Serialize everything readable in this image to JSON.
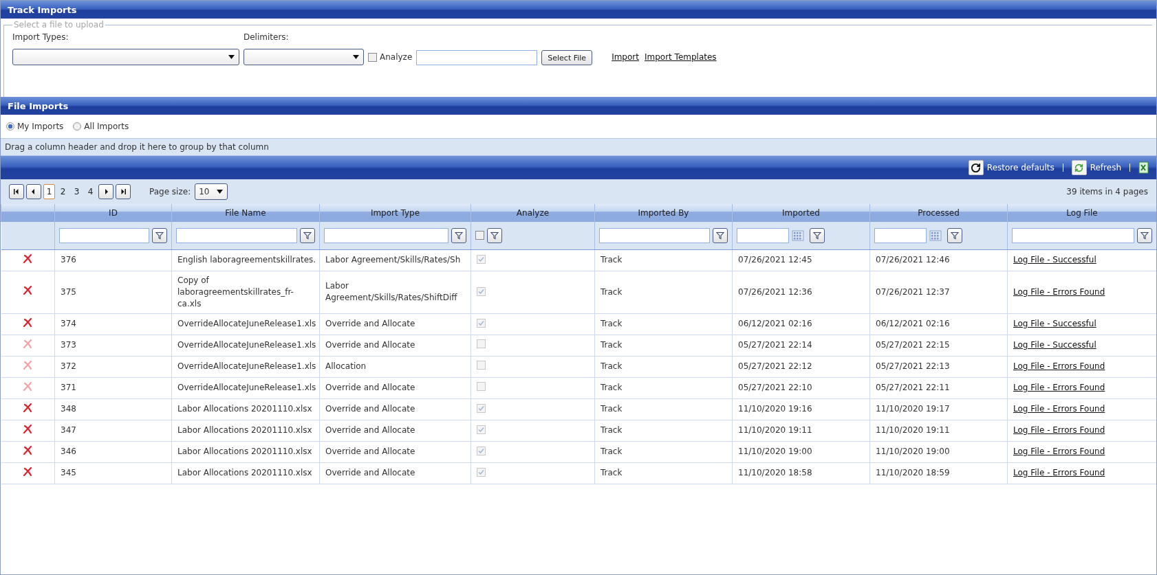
{
  "window": {
    "title": "Track Imports"
  },
  "upload": {
    "legend": "Select a file to upload",
    "import_types_label": "Import Types:",
    "delimiters_label": "Delimiters:",
    "analyze": {
      "label": "Analyze",
      "checked": false
    },
    "select_file_button": "Select File",
    "links": [
      "Import",
      "Import Templates"
    ]
  },
  "file_imports": {
    "title": "File Imports",
    "scope": [
      {
        "label": "My Imports",
        "selected": true
      },
      {
        "label": "All Imports",
        "selected": false
      }
    ],
    "group_hint": "Drag a column header and drop it here to group by that column",
    "toolbar": [
      {
        "kind": "restore",
        "label": "Restore defaults"
      },
      {
        "kind": "refresh",
        "label": "Refresh"
      },
      {
        "kind": "export"
      }
    ],
    "pager": {
      "pages": [
        {
          "label": "1",
          "selected": true
        },
        {
          "label": "2",
          "selected": false
        },
        {
          "label": "3",
          "selected": false
        },
        {
          "label": "4",
          "selected": false
        }
      ],
      "page_size_label": "Page size:",
      "page_size": "10",
      "summary": "39 items in 4 pages"
    },
    "table": {
      "columns": [
        {
          "label": "ID",
          "kind": "text"
        },
        {
          "label": "File Name",
          "kind": "text"
        },
        {
          "label": "Import Type",
          "kind": "text"
        },
        {
          "label": "Analyze",
          "kind": "checkbox",
          "checked": false
        },
        {
          "label": "Imported By",
          "kind": "text"
        },
        {
          "label": "Imported",
          "kind": "date"
        },
        {
          "label": "Processed",
          "kind": "date"
        },
        {
          "label": "Log File",
          "kind": "text"
        }
      ],
      "rows": [
        {
          "deletable": true,
          "id": "376",
          "file_name": "English laboragreementskillrates.",
          "import_type": "Labor Agreement/Skills/Rates/Sh",
          "analyze": true,
          "imported_by": "Track",
          "imported": "07/26/2021 12:45",
          "processed": "07/26/2021 12:46",
          "log_file": "Log File - Successful"
        },
        {
          "deletable": true,
          "id": "375",
          "file_name": "Copy of laboragreementskillrates_fr-ca.xls",
          "import_type": "Labor Agreement/Skills/Rates/ShiftDiff",
          "analyze": true,
          "imported_by": "Track",
          "imported": "07/26/2021 12:36",
          "processed": "07/26/2021 12:37",
          "log_file": "Log File - Errors Found"
        },
        {
          "deletable": true,
          "id": "374",
          "file_name": "OverrideAllocateJuneRelease1.xls",
          "import_type": "Override and Allocate",
          "analyze": true,
          "imported_by": "Track",
          "imported": "06/12/2021 02:16",
          "processed": "06/12/2021 02:16",
          "log_file": "Log File - Successful"
        },
        {
          "deletable": false,
          "id": "373",
          "file_name": "OverrideAllocateJuneRelease1.xls",
          "import_type": "Override and Allocate",
          "analyze": false,
          "imported_by": "Track",
          "imported": "05/27/2021 22:14",
          "processed": "05/27/2021 22:15",
          "log_file": "Log File - Successful"
        },
        {
          "deletable": false,
          "id": "372",
          "file_name": "OverrideAllocateJuneRelease1.xls",
          "import_type": "Allocation",
          "analyze": false,
          "imported_by": "Track",
          "imported": "05/27/2021 22:12",
          "processed": "05/27/2021 22:13",
          "log_file": "Log File - Errors Found"
        },
        {
          "deletable": false,
          "id": "371",
          "file_name": "OverrideAllocateJuneRelease1.xls",
          "import_type": "Override and Allocate",
          "analyze": false,
          "imported_by": "Track",
          "imported": "05/27/2021 22:10",
          "processed": "05/27/2021 22:11",
          "log_file": "Log File - Errors Found"
        },
        {
          "deletable": true,
          "id": "348",
          "file_name": "Labor Allocations 20201110.xlsx",
          "import_type": "Override and Allocate",
          "analyze": true,
          "imported_by": "Track",
          "imported": "11/10/2020 19:16",
          "processed": "11/10/2020 19:17",
          "log_file": "Log File - Errors Found"
        },
        {
          "deletable": true,
          "id": "347",
          "file_name": "Labor Allocations 20201110.xlsx",
          "import_type": "Override and Allocate",
          "analyze": true,
          "imported_by": "Track",
          "imported": "11/10/2020 19:11",
          "processed": "11/10/2020 19:11",
          "log_file": "Log File - Errors Found"
        },
        {
          "deletable": true,
          "id": "346",
          "file_name": "Labor Allocations 20201110.xlsx",
          "import_type": "Override and Allocate",
          "analyze": true,
          "imported_by": "Track",
          "imported": "11/10/2020 19:00",
          "processed": "11/10/2020 19:00",
          "log_file": "Log File - Errors Found"
        },
        {
          "deletable": true,
          "id": "345",
          "file_name": "Labor Allocations 20201110.xlsx",
          "import_type": "Override and Allocate",
          "analyze": true,
          "imported_by": "Track",
          "imported": "11/10/2020 18:58",
          "processed": "11/10/2020 18:59",
          "log_file": "Log File - Errors Found"
        }
      ]
    }
  }
}
